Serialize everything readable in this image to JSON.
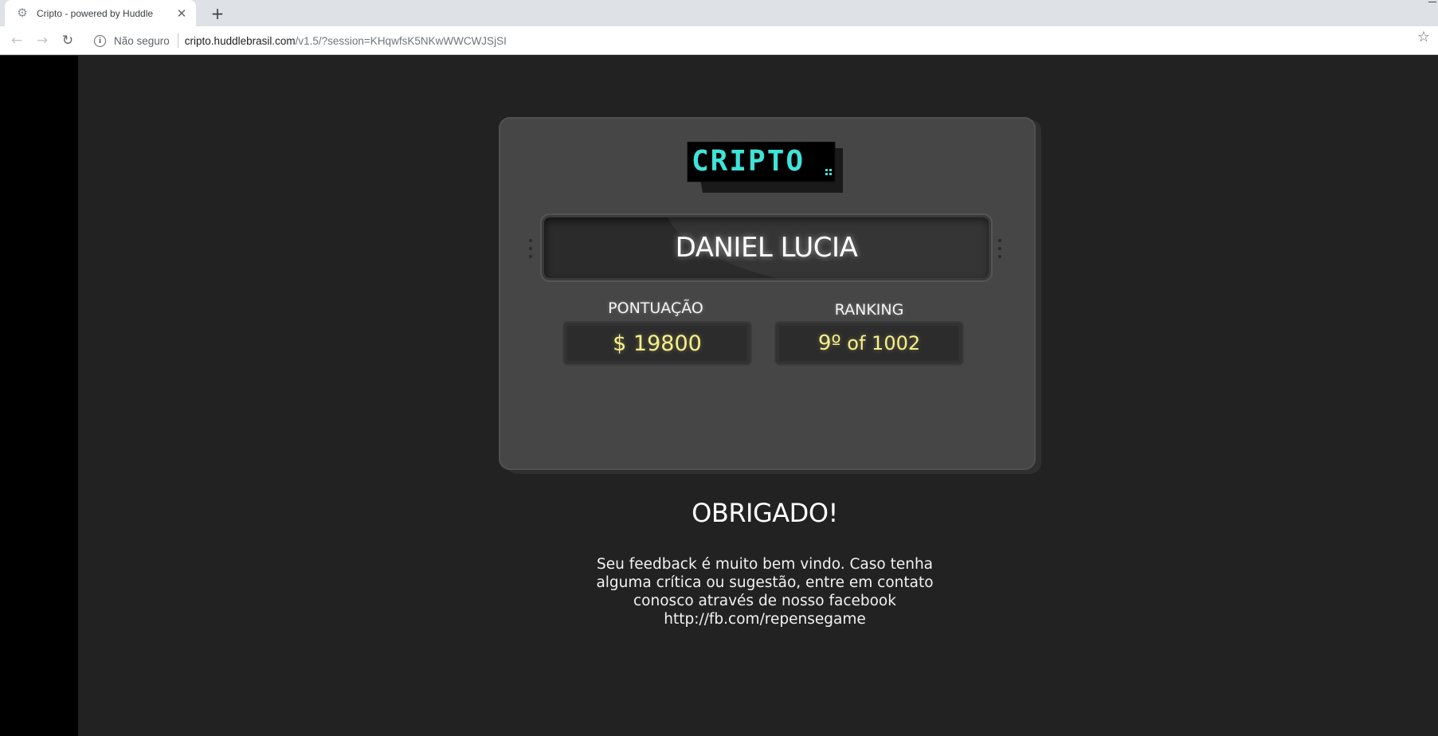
{
  "browser": {
    "tab_title": "Cripto - powered by Huddle",
    "tab_close": "✕",
    "new_tab": "+",
    "back_icon": "←",
    "forward_icon": "→",
    "reload_icon": "↻",
    "security_label": "Não seguro",
    "url_domain": "cripto.huddlebrasil.com",
    "url_path": "/v1.5/?session=KHqwfsK5NKwWWCWJSjSI",
    "bookmark_icon": "☆"
  },
  "game": {
    "logo_text": "CRIPTO",
    "player_name": "DANIEL LUCIA",
    "score_label": "PONTUAÇÃO",
    "score_value": "$ 19800",
    "ranking_label": "RANKING",
    "ranking_position": "9º",
    "ranking_total": "of 1002"
  },
  "footer": {
    "title": "OBRIGADO!",
    "message_lines": [
      "Seu feedback é muito bem vindo. Caso tenha",
      "alguma crítica ou sugestão, entre em contato",
      "conosco através de nosso facebook",
      "http://fb.com/repensegame"
    ]
  },
  "colors": {
    "logo_text": "#3fe3d8",
    "score_text": "#f7ef8a",
    "page_background": "#222222",
    "card_background": "#464646"
  }
}
